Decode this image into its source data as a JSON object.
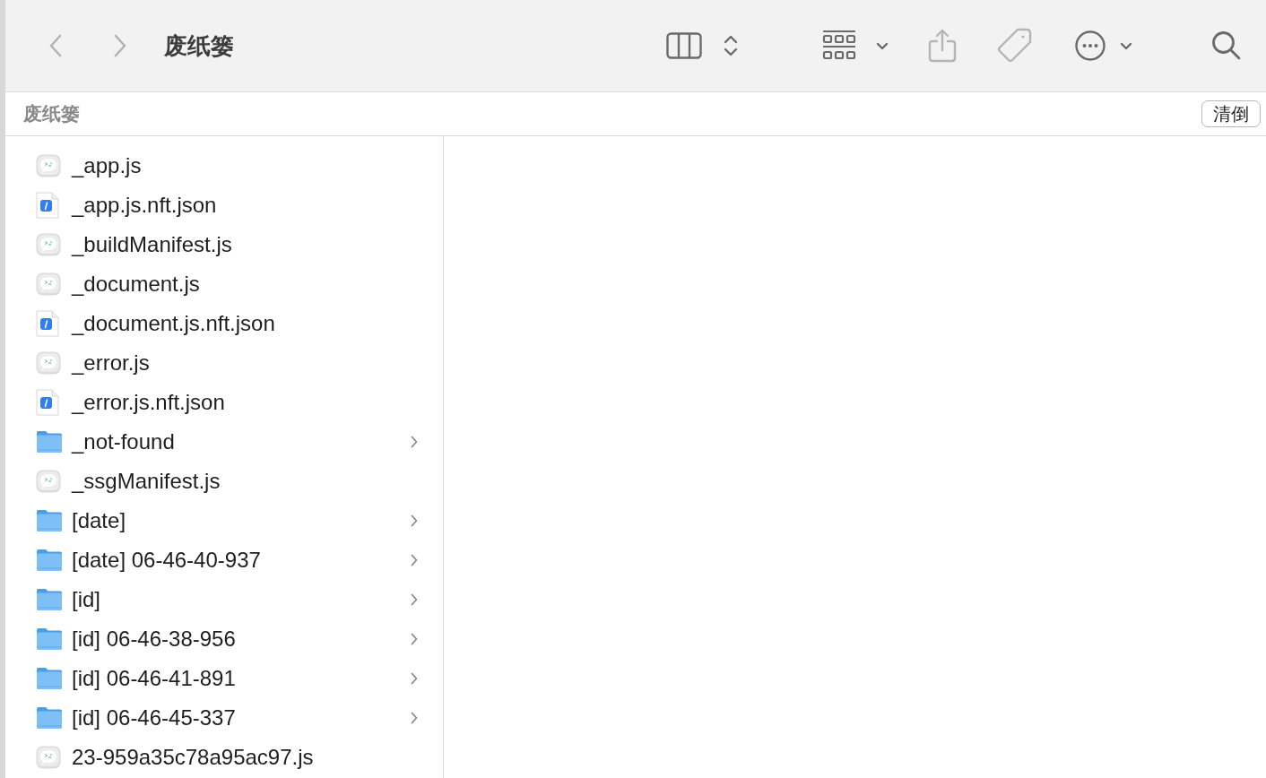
{
  "toolbar": {
    "back": {
      "disabled": true
    },
    "forward": {
      "disabled": true
    },
    "title": "废纸篓",
    "share": {
      "disabled": true
    },
    "tags": {
      "disabled": true
    }
  },
  "path_bar": {
    "location": "废纸篓",
    "empty_button": "清倒"
  },
  "column": {
    "items": [
      {
        "name": "_app.js",
        "kind": "script"
      },
      {
        "name": "_app.js.nft.json",
        "kind": "json"
      },
      {
        "name": "_buildManifest.js",
        "kind": "script"
      },
      {
        "name": "_document.js",
        "kind": "script"
      },
      {
        "name": "_document.js.nft.json",
        "kind": "json"
      },
      {
        "name": "_error.js",
        "kind": "script"
      },
      {
        "name": "_error.js.nft.json",
        "kind": "json"
      },
      {
        "name": "_not-found",
        "kind": "folder"
      },
      {
        "name": "_ssgManifest.js",
        "kind": "script"
      },
      {
        "name": "[date]",
        "kind": "folder"
      },
      {
        "name": "[date] 06-46-40-937",
        "kind": "folder"
      },
      {
        "name": "[id]",
        "kind": "folder"
      },
      {
        "name": "[id] 06-46-38-956",
        "kind": "folder"
      },
      {
        "name": "[id] 06-46-41-891",
        "kind": "folder"
      },
      {
        "name": "[id] 06-46-45-337",
        "kind": "folder"
      },
      {
        "name": "23-959a35c78a95ac97.js",
        "kind": "script"
      }
    ]
  }
}
